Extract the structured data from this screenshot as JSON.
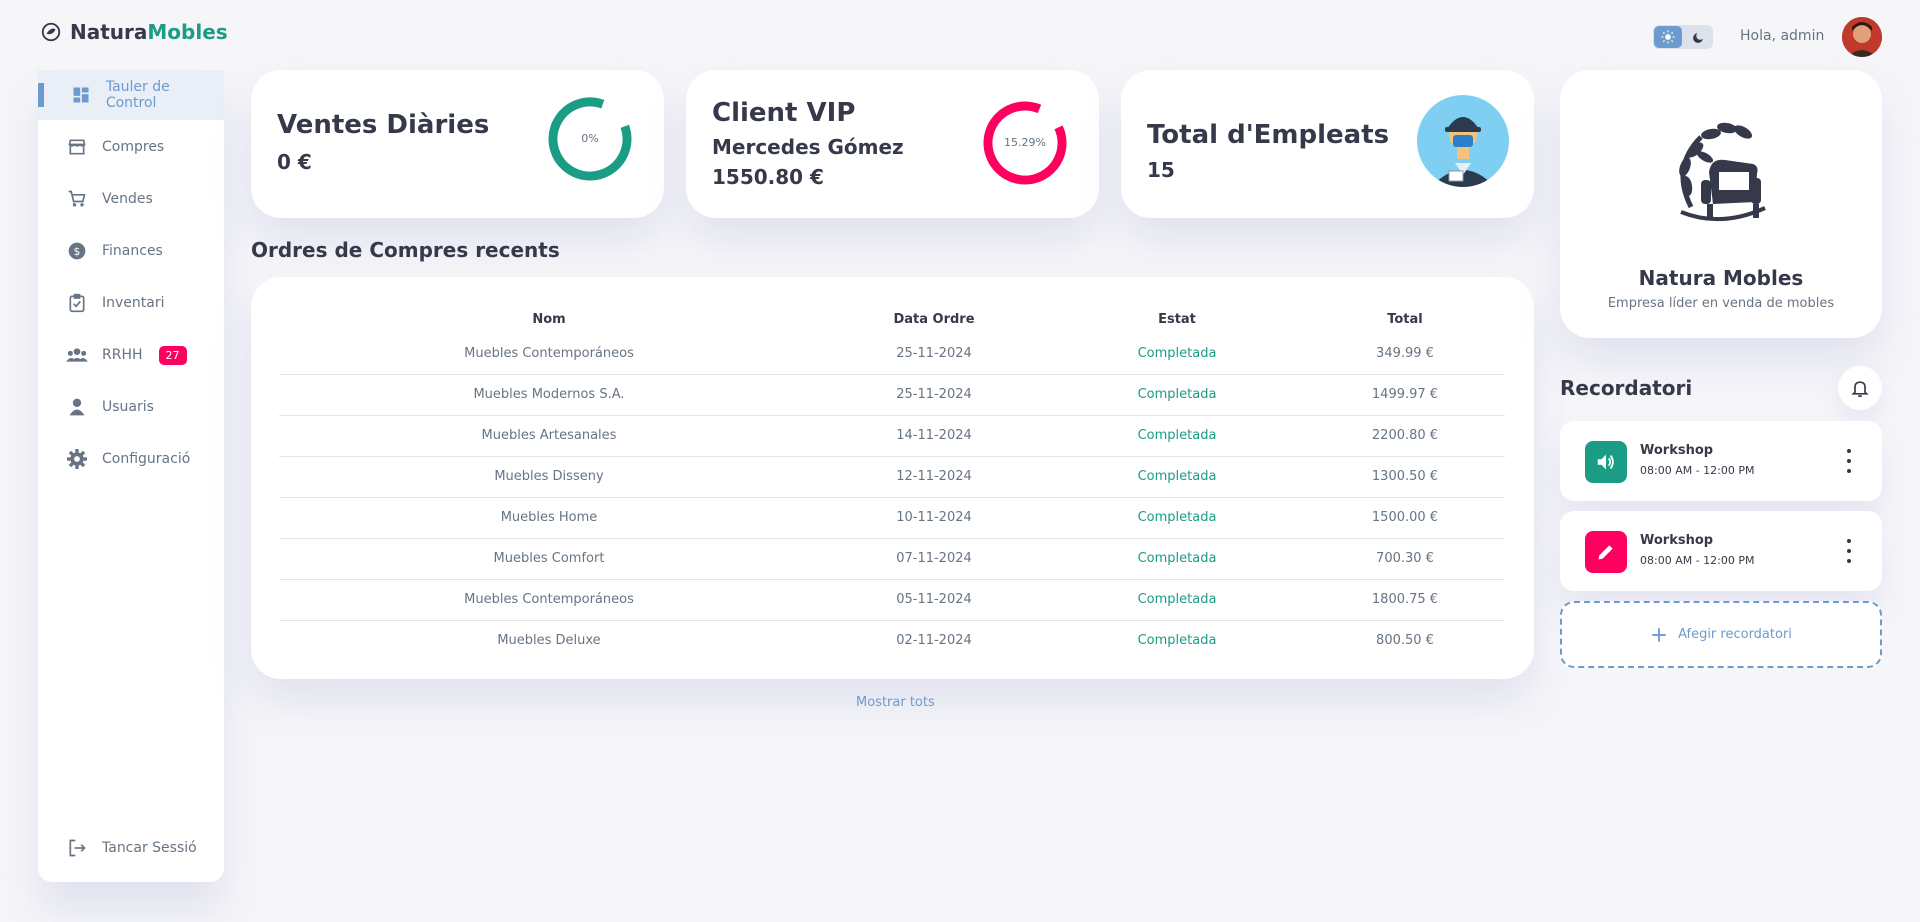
{
  "brand": {
    "part1": "Natura",
    "part2": "Mobles"
  },
  "header": {
    "greeting": "Hola, admin"
  },
  "sidebar": {
    "items": [
      {
        "label": "Tauler de Control",
        "icon": "dashboard-icon",
        "active": true
      },
      {
        "label": "Compres",
        "icon": "store-icon"
      },
      {
        "label": "Vendes",
        "icon": "cart-icon"
      },
      {
        "label": "Finances",
        "icon": "dollar-icon"
      },
      {
        "label": "Inventari",
        "icon": "clipboard-check-icon"
      },
      {
        "label": "RRHH",
        "icon": "people-icon",
        "badge": "27"
      },
      {
        "label": "Usuaris",
        "icon": "person-icon"
      },
      {
        "label": "Configuració",
        "icon": "gear-icon"
      }
    ],
    "logout": {
      "label": "Tancar Sessió",
      "icon": "logout-icon"
    }
  },
  "stats": {
    "sales": {
      "title": "Ventes Diàries",
      "value": "0 €",
      "percent_label": "0%",
      "percent": 0,
      "color": "#1b9c85"
    },
    "vip": {
      "title": "Client VIP",
      "name": "Mercedes Gómez",
      "value": "1550.80 €",
      "percent_label": "15.29%",
      "percent": 15.29,
      "color": "#ff0060"
    },
    "employees": {
      "title": "Total d'Empleats",
      "value": "15"
    }
  },
  "orders": {
    "title": "Ordres de Compres recents",
    "columns": [
      "Nom",
      "Data Ordre",
      "Estat",
      "Total"
    ],
    "rows": [
      [
        "Muebles Contemporáneos",
        "25-11-2024",
        "Completada",
        "349.99 €"
      ],
      [
        "Muebles Modernos S.A.",
        "25-11-2024",
        "Completada",
        "1499.97 €"
      ],
      [
        "Muebles Artesanales",
        "14-11-2024",
        "Completada",
        "2200.80 €"
      ],
      [
        "Muebles Disseny",
        "12-11-2024",
        "Completada",
        "1300.50 €"
      ],
      [
        "Muebles Home",
        "10-11-2024",
        "Completada",
        "1500.00 €"
      ],
      [
        "Muebles Comfort",
        "07-11-2024",
        "Completada",
        "700.30 €"
      ],
      [
        "Muebles Contemporáneos",
        "05-11-2024",
        "Completada",
        "1800.75 €"
      ],
      [
        "Muebles Deluxe",
        "02-11-2024",
        "Completada",
        "800.50 €"
      ]
    ],
    "show_all": "Mostrar tots"
  },
  "company": {
    "name": "Natura Mobles",
    "description": "Empresa líder en venda de mobles"
  },
  "reminders": {
    "title": "Recordatori",
    "items": [
      {
        "name": "Workshop",
        "time": "08:00 AM - 12:00 PM",
        "icon": "volume-icon",
        "color": "#1b9c85"
      },
      {
        "name": "Workshop",
        "time": "08:00 AM - 12:00 PM",
        "icon": "pencil-icon",
        "color": "#ff0060"
      }
    ],
    "add_label": "Afegir recordatori"
  },
  "colors": {
    "primary": "#6c9bcf",
    "success": "#1b9c85",
    "danger": "#ff0060",
    "background": "#f6f6f9"
  }
}
